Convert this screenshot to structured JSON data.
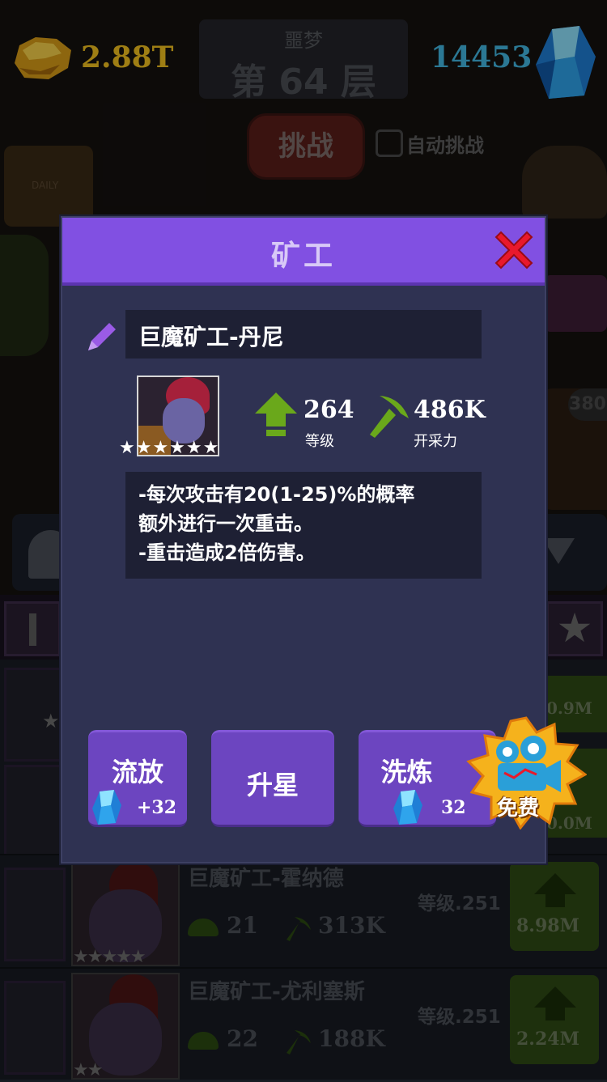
{
  "hud": {
    "gold": "2.88T",
    "gems": "14453",
    "mode": "噩梦",
    "floor": "第 64 层",
    "challenge_label": "挑战",
    "auto_challenge_label": "自动挑战"
  },
  "background": {
    "daily_label": "DAILY",
    "side_badge": "380",
    "star_count": "★★★★★★"
  },
  "miner_list": [
    {
      "name": "巨魔矿工-霍纳德",
      "level": "等级.251",
      "upgrade": "21",
      "power": "313K",
      "cost": "8.98M",
      "stars": "★★★★★"
    },
    {
      "name": "巨魔矿工-尤利塞斯",
      "level": "等级.251",
      "upgrade": "22",
      "power": "188K",
      "cost": "2.24M",
      "stars": "★★"
    }
  ],
  "partial_costs": [
    "0.9M",
    "0.0M"
  ],
  "dialog": {
    "title": "矿工",
    "miner_name": "巨魔矿工-丹尼",
    "stars": "★★★★★★",
    "level_value": "264",
    "level_label": "等级",
    "power_value": "486K",
    "power_label": "开采力",
    "description": [
      "-每次攻击有20(1-25)%的概率",
      "额外进行一次重击。",
      "-重击造成2倍伤害。"
    ],
    "buttons": {
      "exile_label": "流放",
      "exile_cost": "+32",
      "star_label": "升星",
      "refine_label": "洗炼",
      "refine_cost": "32"
    },
    "free_label": "免费"
  },
  "icons": {
    "gold": "gold-nugget-icon",
    "gem": "blue-gem-icon",
    "close": "close-x-icon",
    "edit": "pencil-icon",
    "level": "green-up-arrow-icon",
    "power": "pickaxe-icon",
    "free": "film-camera-icon"
  },
  "colors": {
    "header": "#8150e2",
    "dialog_bg": "#2f3252",
    "button": "#6c45c0",
    "gold_text": "#f3c21f",
    "gem_text": "#43b9e3",
    "close_red": "#e8192c",
    "level_green": "#6aa81b"
  }
}
